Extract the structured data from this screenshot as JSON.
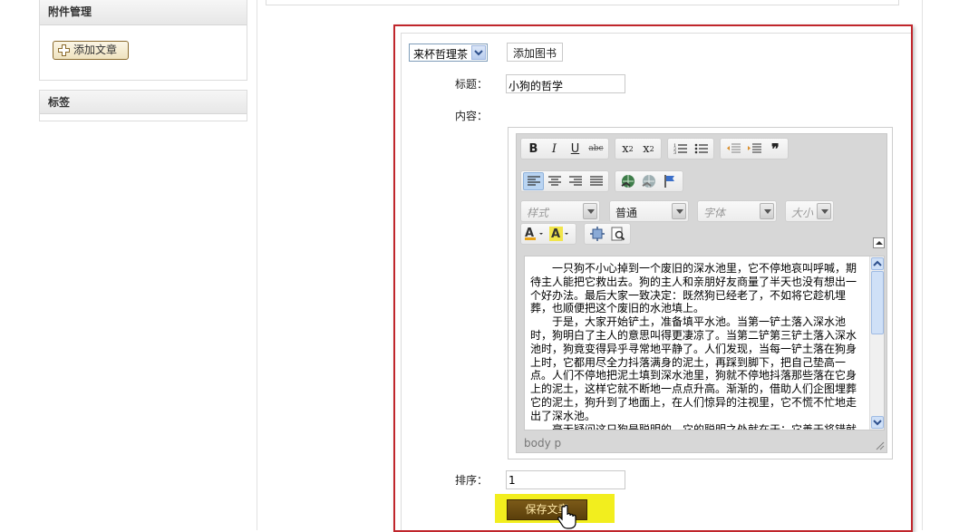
{
  "sidebar": {
    "attach_title": "附件管理",
    "add_article_label": "添加文章",
    "tags_title": "标签"
  },
  "form": {
    "book_select_value": "来杯哲理茶",
    "add_book_label": "添加图书",
    "title_label": "标题：",
    "title_value": "小狗的哲学",
    "content_label": "内容：",
    "order_label": "排序：",
    "order_value": "1",
    "save_label": "保存文章"
  },
  "editor": {
    "style_placeholder": "样式",
    "format_value": "普通",
    "font_placeholder": "字体",
    "size_placeholder": "大小",
    "path": "body  p",
    "paragraphs": [
      "一只狗不小心掉到一个废旧的深水池里，它不停地哀叫呼喊，期待主人能把它救出去。狗的主人和亲朋好友商量了半天也没有想出一个好办法。最后大家一致决定：既然狗已经老了，不如将它趁机埋葬，也顺便把这个废旧的水池填上。",
      "于是，大家开始铲土，准备填平水池。当第一铲土落入深水池时，狗明白了主人的意思叫得更凄凉了。当第二铲第三铲土落入深水池时，狗竟变得异乎寻常地平静了。人们发现，当每一铲土落在狗身上时，它都用尽全力抖落满身的泥土，再踩到脚下，把自己垫高一点。人们不停地把泥土填到深水池里，狗就不停地抖落那些落在它身上的泥土，这样它就不断地一点点升高。渐渐的，借助人们企图埋葬它的泥土，狗升到了地面上，在人们惊异的注视里，它不慌不忙地走出了深水池。",
      "毫无疑问这只狗是聪明的，它的聪明之处就在于：它善于将错就错"
    ]
  }
}
